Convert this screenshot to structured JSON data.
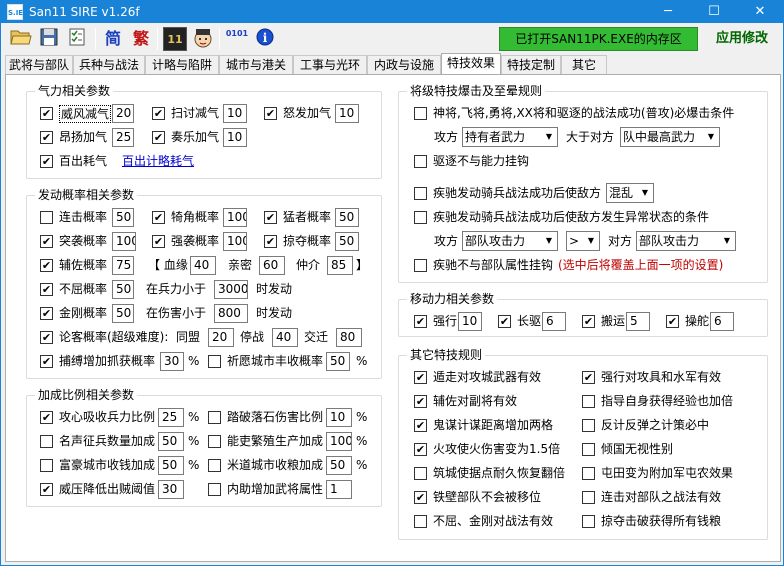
{
  "window": {
    "title": "San11 SIRE v1.26f",
    "app_icon_text": "S.IE"
  },
  "titlebar_buttons": {
    "minimize": "─",
    "maximize": "☐",
    "close": "✕"
  },
  "toolbar": {
    "open_icon": "folder-open-icon",
    "save_icon": "save-disk-icon",
    "check_icon": "checklist-icon",
    "simplified_label": "简",
    "traditional_label": "繁",
    "calc_label": "11",
    "character_icon": "character-face-icon",
    "binary_label": "0101",
    "info_label": "i",
    "status_text": "已打开SAN11PK.EXE的内存区",
    "apply_label": "应用修改"
  },
  "tabs": [
    "武将与部队",
    "兵种与战法",
    "计略与陷阱",
    "城市与港关",
    "工事与光环",
    "内政与设施",
    "特技效果",
    "特技定制",
    "其它"
  ],
  "active_tab": 6,
  "groups": {
    "qili": "气力相关参数",
    "fadong": "发动概率相关参数",
    "jiacheng": "加成比例相关参数",
    "jiangji": "将级特技爆击及至晕规则",
    "yidong": "移动力相关参数",
    "qita": "其它特技规则"
  },
  "qili": {
    "weifeng": {
      "label": "威风减气",
      "value": "20",
      "checked": true
    },
    "saotao": {
      "label": "扫讨减气",
      "value": "10",
      "checked": true
    },
    "nufa": {
      "label": "怒发加气",
      "value": "10",
      "checked": true
    },
    "angyang": {
      "label": "昂扬加气",
      "value": "25",
      "checked": true
    },
    "zouyue": {
      "label": "奏乐加气",
      "value": "10",
      "checked": true
    },
    "baichu": {
      "label": "百出耗气",
      "checked": true
    },
    "baichu_link": "百出计略耗气"
  },
  "fadong": {
    "lianji": {
      "label": "连击概率",
      "value": "50",
      "checked": false
    },
    "jijiao": {
      "label": "犄角概率",
      "value": "100",
      "checked": true
    },
    "mengzhe": {
      "label": "猛者概率",
      "value": "50",
      "checked": true
    },
    "tuxi": {
      "label": "突袭概率",
      "value": "100",
      "checked": true
    },
    "qiangxi": {
      "label": "强袭概率",
      "value": "100",
      "checked": true
    },
    "lveduo": {
      "label": "掠夺概率",
      "value": "50",
      "checked": true
    },
    "buzuo": {
      "label": "辅佐概率",
      "value": "75",
      "checked": true
    },
    "xueyuan_label": "【 血缘",
    "xueyuan_value": "40",
    "qinmi_label": "亲密",
    "qinmi_value": "60",
    "zhongjie_label": "仲介",
    "zhongjie_value": "85",
    "close_bracket": "】",
    "buqu": {
      "label": "不屈概率",
      "value": "50",
      "checked": true
    },
    "buqu_mid": "在兵力小于",
    "buqu_value2": "3000",
    "buqu_end": "时发动",
    "jingang": {
      "label": "金刚概率",
      "value": "50",
      "checked": true
    },
    "jingang_mid": "在伤害小于",
    "jingang_value2": "800",
    "jingang_end": "时发动",
    "lunke": {
      "label": "论客概率(超级难度):",
      "checked": true
    },
    "tongmeng_label": "同盟",
    "tongmeng_value": "20",
    "tingzhan_label": "停战",
    "tingzhan_value": "40",
    "jiaoqian_label": "交迁",
    "jiaoqian_value": "80",
    "bufu": {
      "label": "捕缚增加抓获概率",
      "value": "30",
      "checked": true
    },
    "bufu_unit": "%",
    "qiyuan": {
      "label": "祈愿城市丰收概率",
      "value": "50",
      "checked": false
    },
    "qiyuan_unit": "%"
  },
  "jiacheng": {
    "gongxin": {
      "label": "攻心吸收兵力比例",
      "value": "25",
      "checked": true,
      "unit": "%"
    },
    "tapo": {
      "label": "踏破落石伤害比例",
      "value": "10",
      "checked": false,
      "unit": "%"
    },
    "mingsheng": {
      "label": "名声征兵数量加成",
      "value": "50",
      "checked": false,
      "unit": "%"
    },
    "nengli": {
      "label": "能吏繁殖生产加成",
      "value": "100",
      "checked": false,
      "unit": "%"
    },
    "fuhao": {
      "label": "富豪城市收钱加成",
      "value": "50",
      "checked": false,
      "unit": "%"
    },
    "midao": {
      "label": "米道城市收粮加成",
      "value": "50",
      "checked": false,
      "unit": "%"
    },
    "weiya": {
      "label": "威压降低出贼阈值",
      "value": "30",
      "checked": true
    },
    "neizhu": {
      "label": "内助增加武将属性",
      "value": "1",
      "checked": false
    }
  },
  "jiangji": {
    "shenjiang": {
      "label": "神将,飞将,勇将,XX将和驱逐的战法成功(普攻)必爆击条件",
      "checked": false
    },
    "gongfang_label": "攻方",
    "gongfang_select": "持有者武力",
    "dayu_label": "大于对方",
    "duifang_select": "队中最高武力",
    "quzhu": {
      "label": "驱逐不与能力挂钩",
      "checked": false
    },
    "jichi1": {
      "label": "疾驰发动骑兵战法成功后使敌方",
      "checked": false
    },
    "jichi1_select": "混乱",
    "jichi2": {
      "label": "疾驰发动骑兵战法成功后使敌方发生异常状态的条件",
      "checked": false
    },
    "gongfang2_label": "攻方",
    "gongfang2_select": "部队攻击力",
    "compare_select": ">",
    "duifang2_label": "对方",
    "duifang2_select": "部队攻击力",
    "jichi3": {
      "label": "疾驰不与部队属性挂钩",
      "checked": false
    },
    "jichi3_note": "(选中后将覆盖上面一项的设置)"
  },
  "yidong": {
    "qiangxing": {
      "label": "强行",
      "value": "10",
      "checked": true
    },
    "changqu": {
      "label": "长驱",
      "value": "6",
      "checked": true
    },
    "banyun": {
      "label": "搬运",
      "value": "5",
      "checked": true
    },
    "caoduo": {
      "label": "操舵",
      "value": "6",
      "checked": true
    }
  },
  "qita": {
    "left": [
      {
        "label": "遁走对攻城武器有效",
        "checked": true
      },
      {
        "label": "辅佐对副将有效",
        "checked": true
      },
      {
        "label": "鬼谋计谋距离增加两格",
        "checked": true
      },
      {
        "label": "火攻使火伤害变为1.5倍",
        "checked": true
      },
      {
        "label": "筑城使据点耐久恢复翻倍",
        "checked": false
      },
      {
        "label": "铁壁部队不会被移位",
        "checked": true
      },
      {
        "label": "不屈、金刚对战法有效",
        "checked": false
      }
    ],
    "right": [
      {
        "label": "强行对攻具和水军有效",
        "checked": true
      },
      {
        "label": "指导自身获得经验也加倍",
        "checked": false
      },
      {
        "label": "反计反弹之计策必中",
        "checked": false
      },
      {
        "label": "倾国无视性别",
        "checked": false
      },
      {
        "label": "屯田变为附加军屯农效果",
        "checked": false
      },
      {
        "label": "连击对部队之战法有效",
        "checked": false
      },
      {
        "label": "掠夺击破获得所有钱粮",
        "checked": false
      }
    ]
  },
  "check_glyph": "✔"
}
